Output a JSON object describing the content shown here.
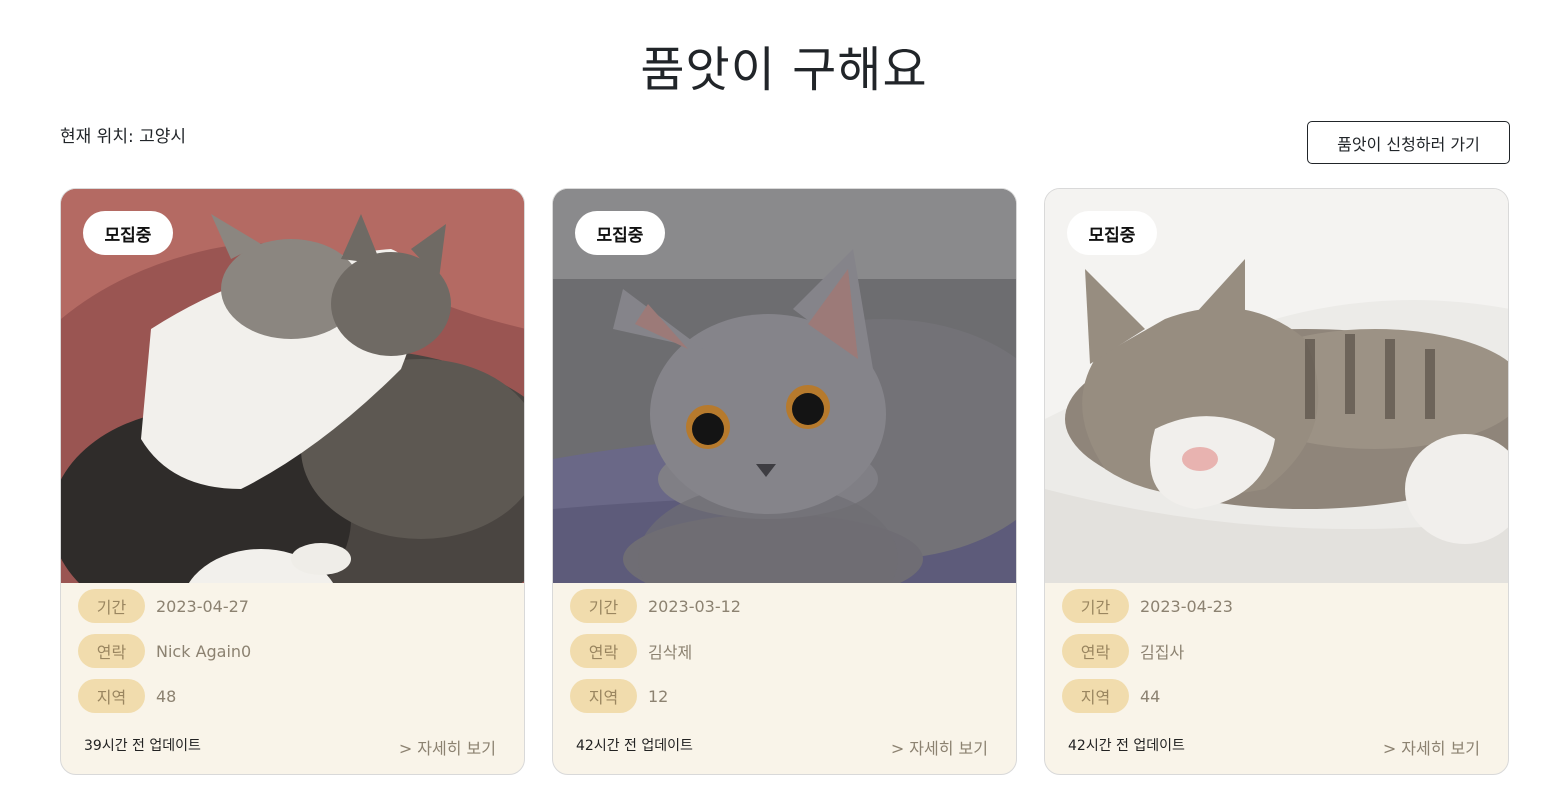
{
  "header": {
    "title": "품앗이 구해요",
    "location": "현재 위치: 고양시",
    "apply_button": "품앗이 신청하러 가기"
  },
  "cards": [
    {
      "status": "모집중",
      "period_label": "기간",
      "period": "2023-04-27",
      "contact_label": "연락",
      "contact": "Nick Again0",
      "region_label": "지역",
      "region": "48",
      "updated": "39시간 전 업데이트",
      "detail": "> 자세히 보기"
    },
    {
      "status": "모집중",
      "period_label": "기간",
      "period": "2023-03-12",
      "contact_label": "연락",
      "contact": "김삭제",
      "region_label": "지역",
      "region": "12",
      "updated": "42시간 전 업데이트",
      "detail": "> 자세히 보기"
    },
    {
      "status": "모집중",
      "period_label": "기간",
      "period": "2023-04-23",
      "contact_label": "연락",
      "contact": "김집사",
      "region_label": "지역",
      "region": "44",
      "updated": "42시간 전 업데이트",
      "detail": "> 자세히 보기"
    }
  ],
  "colors": {
    "card_bg": "#f9f4e9",
    "label_bg": "#f1dcad",
    "label_text": "#9a8660",
    "value_text": "#8c8271"
  }
}
